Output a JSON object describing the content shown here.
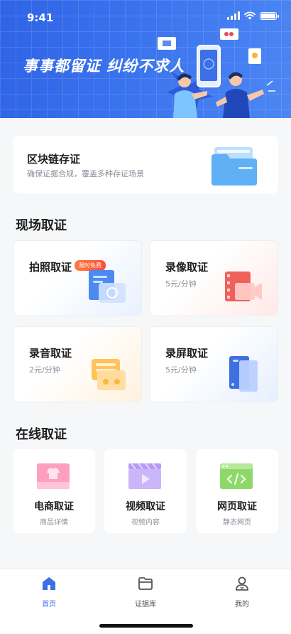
{
  "status_bar": {
    "time": "9:41"
  },
  "hero": {
    "slogan": "事事都留证  纠纷不求人"
  },
  "blockchain_card": {
    "title": "区块链存证",
    "subtitle": "确保证据合规，覆盖多种存证场景"
  },
  "onsite": {
    "title": "现场取证",
    "items": [
      {
        "label": "拍照取证",
        "badge": "限时免费",
        "icon": "photo-icon"
      },
      {
        "label": "录像取证",
        "price": "5元/分钟",
        "icon": "video-icon"
      },
      {
        "label": "录音取证",
        "price": "2元/分钟",
        "icon": "audio-icon"
      },
      {
        "label": "录屏取证",
        "price": "5元/分钟",
        "icon": "screen-record-icon"
      }
    ]
  },
  "online": {
    "title": "在线取证",
    "items": [
      {
        "label": "电商取证",
        "sub": "商品详情",
        "icon": "ecommerce-icon"
      },
      {
        "label": "视频取证",
        "sub": "视频内容",
        "icon": "video-play-icon"
      },
      {
        "label": "网页取证",
        "sub": "静态网页",
        "icon": "webpage-code-icon"
      }
    ]
  },
  "tabbar": {
    "items": [
      {
        "label": "首页",
        "icon": "home-icon",
        "active": true
      },
      {
        "label": "证据库",
        "icon": "folder-icon",
        "active": false
      },
      {
        "label": "我的",
        "icon": "user-icon",
        "active": false
      }
    ]
  },
  "colors": {
    "primary": "#3a6fe6",
    "badge": "#ff5a3d"
  }
}
